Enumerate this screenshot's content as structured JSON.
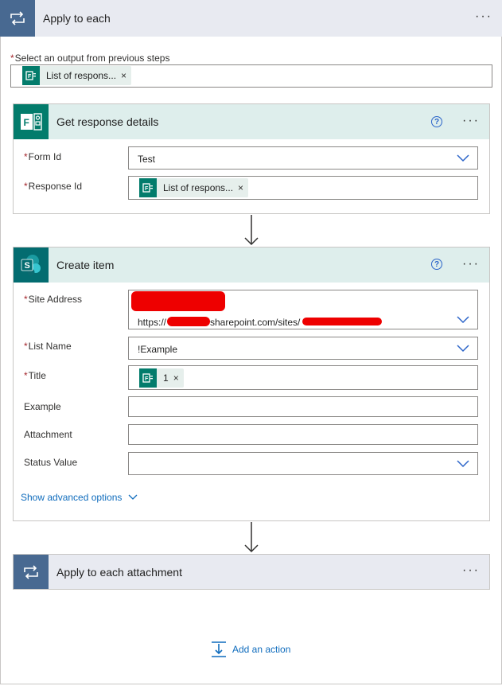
{
  "apply_to_each": {
    "title": "Apply to each",
    "more_label": "···",
    "output_label": "Select an output from previous steps",
    "output_token": "List of respons..."
  },
  "get_response": {
    "title": "Get response details",
    "help": "?",
    "form_id_label": "Form Id",
    "form_id_value": "Test",
    "response_id_label": "Response Id",
    "response_id_token": "List of respons..."
  },
  "create_item": {
    "title": "Create item",
    "help": "?",
    "site_address_label": "Site Address",
    "site_url_prefix": "https://",
    "site_url_mid": "sharepoint.com/sites/",
    "list_name_label": "List Name",
    "list_name_value": "!Example",
    "title_label": "Title",
    "title_token": "1",
    "example_label": "Example",
    "attachment_label": "Attachment",
    "status_label": "Status Value",
    "advanced_label": "Show advanced options"
  },
  "apply_attachment": {
    "title": "Apply to each attachment"
  },
  "add_action_label": "Add an action",
  "colors": {
    "loop_header": "#e8eaf1",
    "loop_icon": "#486991",
    "forms_green": "#037c6c",
    "sharepoint_teal": "#036c70",
    "card_header": "#deeeec",
    "link_blue": "#0f6cbd",
    "required_red": "#a4262c"
  }
}
